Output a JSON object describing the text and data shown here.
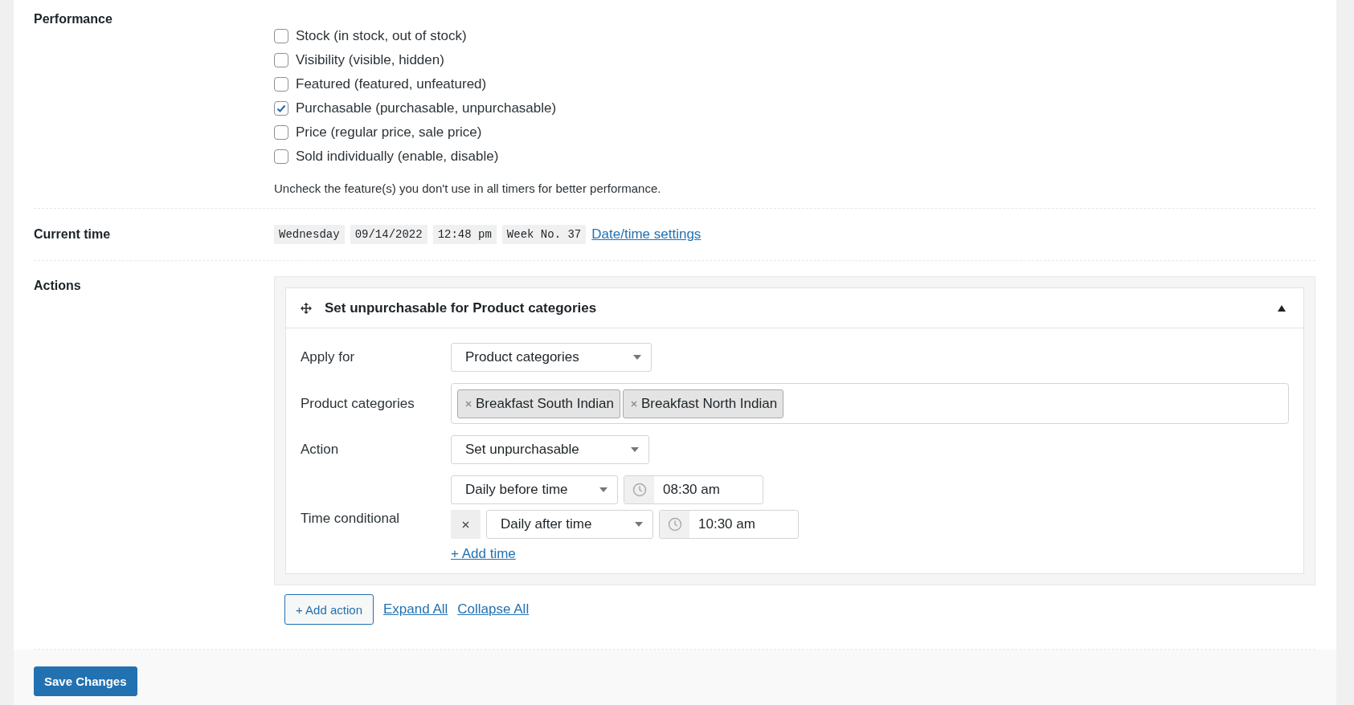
{
  "performance": {
    "label": "Performance",
    "options": [
      {
        "label": "Stock (in stock, out of stock)",
        "checked": false
      },
      {
        "label": "Visibility (visible, hidden)",
        "checked": false
      },
      {
        "label": "Featured (featured, unfeatured)",
        "checked": false
      },
      {
        "label": "Purchasable (purchasable, unpurchasable)",
        "checked": true
      },
      {
        "label": "Price (regular price, sale price)",
        "checked": false
      },
      {
        "label": "Sold individually (enable, disable)",
        "checked": false
      }
    ],
    "note": "Uncheck the feature(s) you don't use in all timers for better performance."
  },
  "current_time": {
    "label": "Current time",
    "chips": [
      "Wednesday",
      "09/14/2022",
      "12:48 pm",
      "Week No. 37"
    ],
    "link": "Date/time settings"
  },
  "actions": {
    "label": "Actions",
    "items": [
      {
        "title": "Set unpurchasable for Product categories",
        "expanded": true,
        "apply_for": {
          "label": "Apply for",
          "value": "Product categories"
        },
        "categories": {
          "label": "Product categories",
          "tags": [
            "Breakfast South Indian",
            "Breakfast North Indian"
          ]
        },
        "action": {
          "label": "Action",
          "value": "Set unpurchasable"
        },
        "time_conditional": {
          "label": "Time conditional",
          "conditions": [
            {
              "type": "Daily before time",
              "time": "08:30 am",
              "removable": false
            },
            {
              "type": "Daily after time",
              "time": "10:30 am",
              "removable": true
            }
          ],
          "add_link": "+ Add time"
        }
      }
    ],
    "add_button": "+ Add action",
    "expand_all": "Expand All",
    "collapse_all": "Collapse All"
  },
  "save_button": "Save Changes"
}
